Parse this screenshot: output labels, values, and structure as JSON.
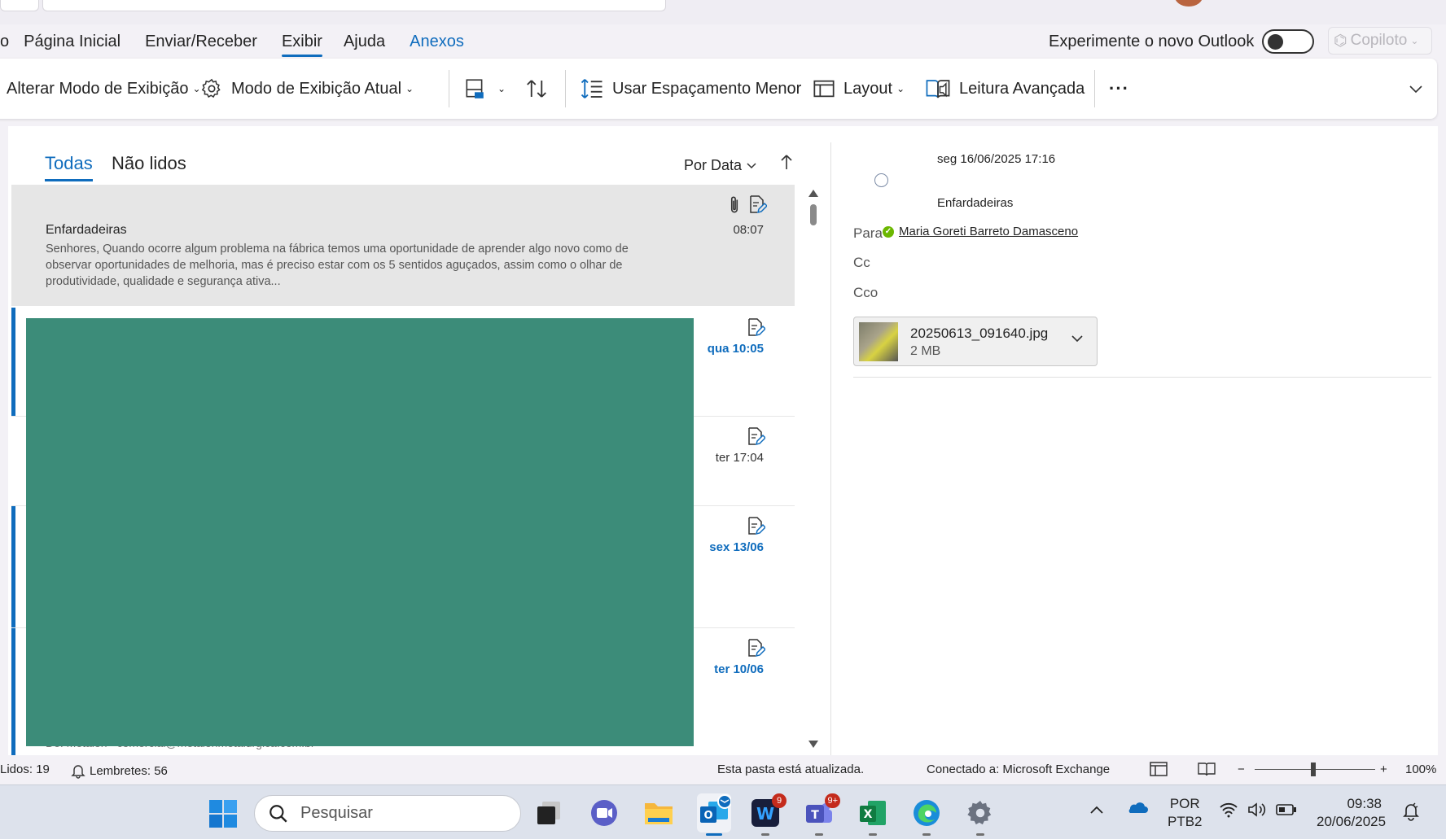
{
  "ribbon_tabs": [
    "o",
    "Página Inicial",
    "Enviar/Receber",
    "Exibir",
    "Ajuda",
    "Anexos"
  ],
  "active_tab": "Exibir",
  "new_outlook_label": "Experimente o novo Outlook",
  "copilot_label": "Copiloto",
  "toolbar": {
    "change_view": "Alterar Modo de Exibição",
    "current_view": "Modo de Exibição Atual",
    "smaller_spacing": "Usar Espaçamento Menor",
    "layout": "Layout",
    "immersive_reader": "Leitura Avançada",
    "more": "···"
  },
  "list": {
    "filter_all": "Todas",
    "filter_unread": "Não lidos",
    "sort_by": "Por Data",
    "selected": {
      "sender": "Enfardadeiras",
      "preview": "Senhores,  Quando ocorre algum problema na fábrica temos uma oportunidade de aprender algo novo como de observar oportunidades de melhoria, mas é preciso estar com os 5 sentidos aguçados, assim como o olhar de produtividade,  qualidade e segurança ativa...",
      "time": "08:07"
    },
    "rows": [
      {
        "time": "qua 10:05",
        "unread": true
      },
      {
        "time": "ter 17:04",
        "unread": false
      },
      {
        "time": "sex 13/06",
        "unread": true
      },
      {
        "time": "ter 10/06",
        "unread": true
      }
    ],
    "bottom_partial": "De: Metalon <comercial@metalonmetalurgica.com.br>"
  },
  "reading": {
    "date": "seg 16/06/2025 17:16",
    "sender": "Enfardadeiras",
    "to_label": "Para",
    "to_name": "Maria Goreti Barreto Damasceno",
    "cc_label": "Cc",
    "bcc_label": "Cco",
    "attachment_name": "20250613_091640.jpg",
    "attachment_size": "2 MB"
  },
  "status": {
    "read": "Lidos: 19",
    "reminders": "Lembretes: 56",
    "folder_status": "Esta pasta está atualizada.",
    "connection": "Conectado a: Microsoft Exchange",
    "zoom": "100%"
  },
  "taskbar": {
    "search_placeholder": "Pesquisar",
    "woody_badge": "9",
    "teams_badge": "9+",
    "lang_top": "POR",
    "lang_bottom": "PTB2",
    "time": "09:38",
    "date": "20/06/2025"
  },
  "colors": {
    "accent": "#0f6cbd",
    "redaction": "#3c8c79",
    "presence": "#6bb700"
  }
}
